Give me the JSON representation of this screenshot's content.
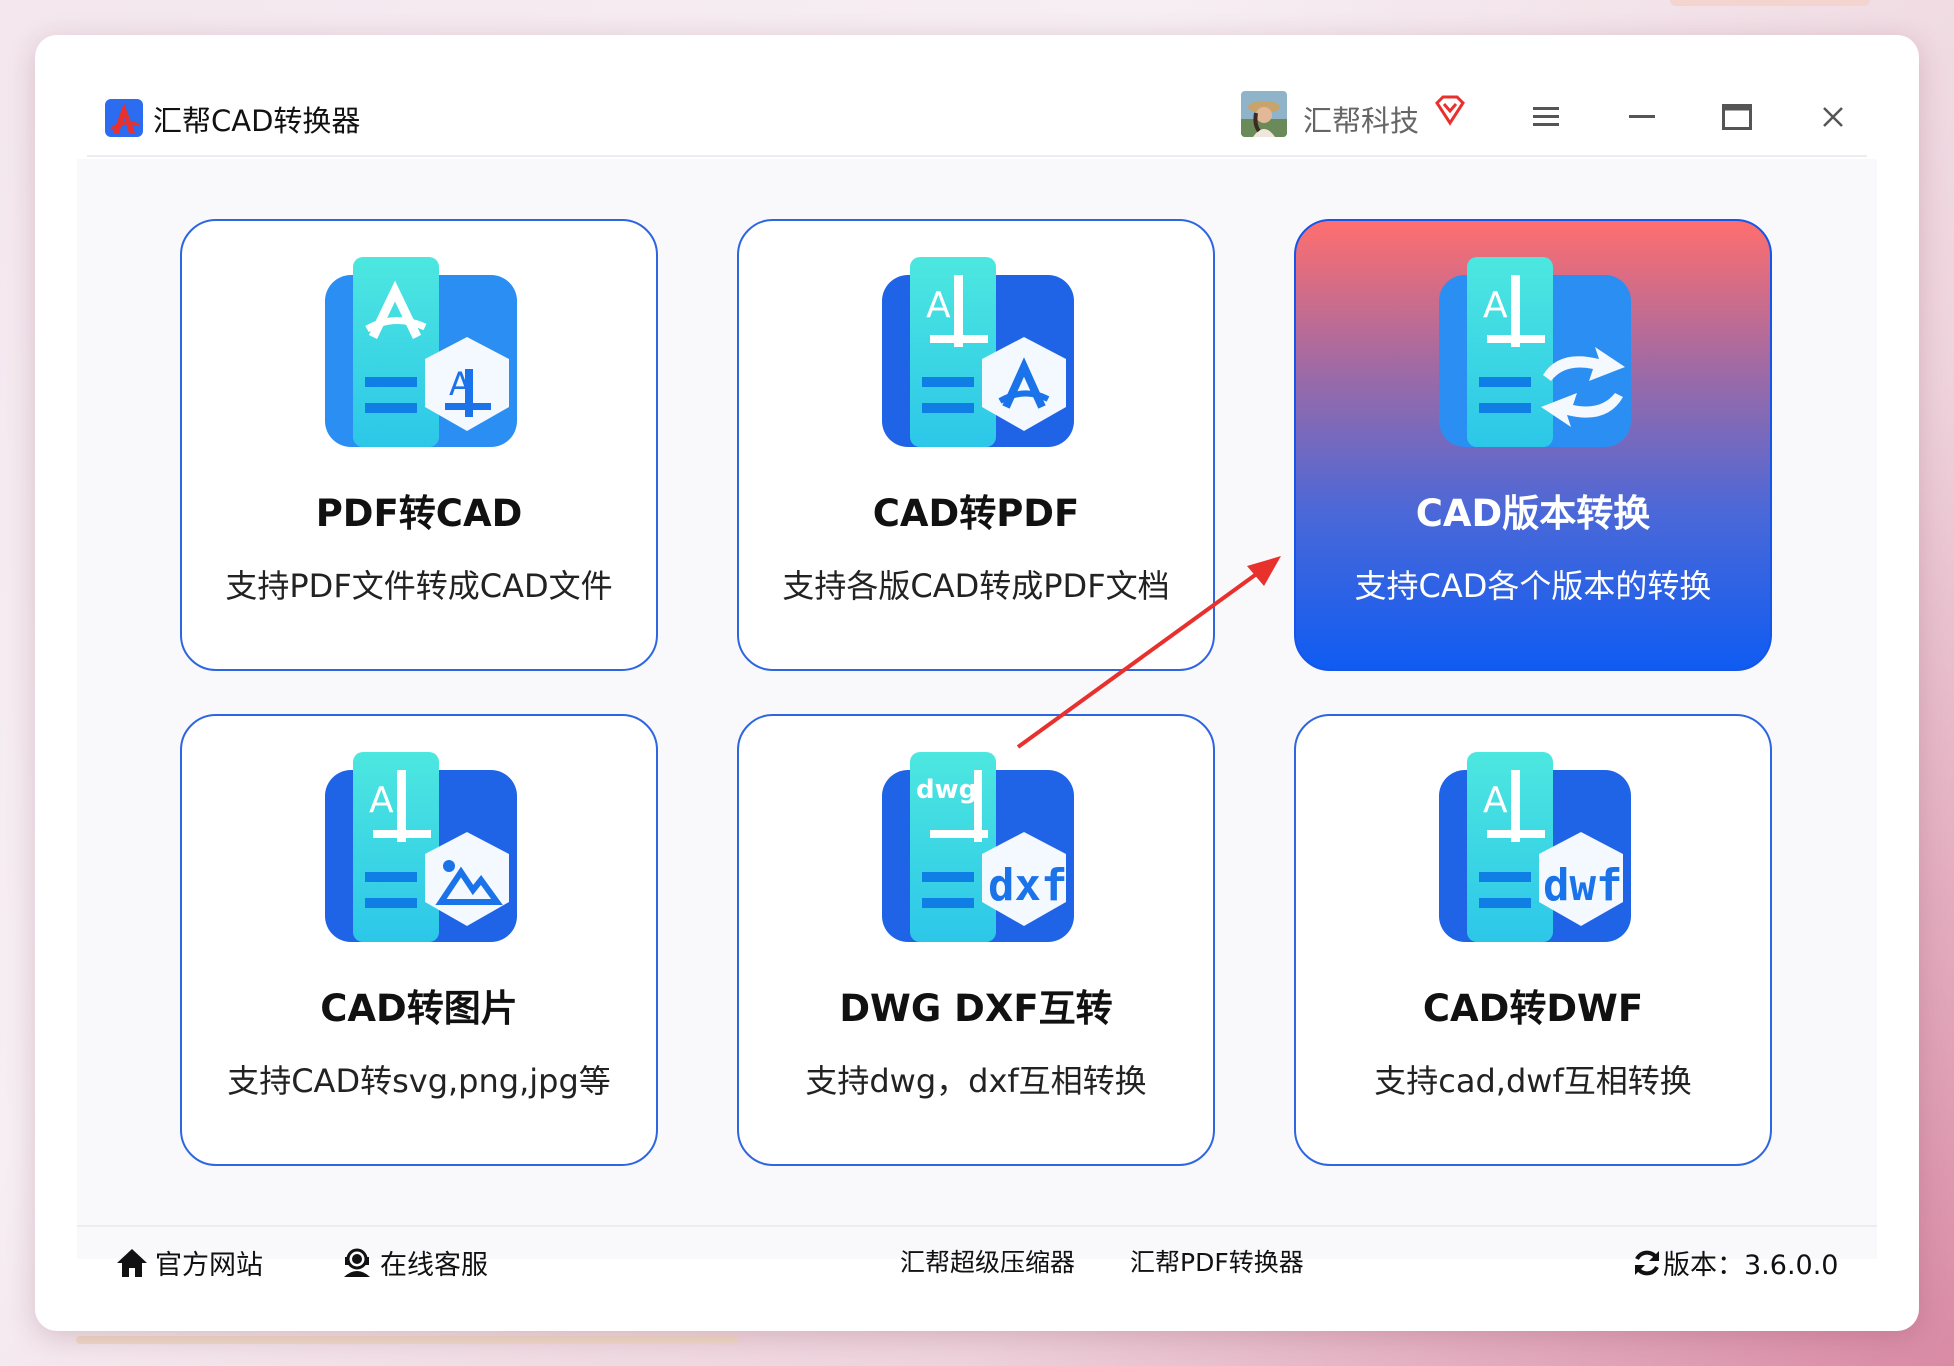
{
  "app": {
    "title": "汇帮CAD转换器"
  },
  "user": {
    "name": "汇帮科技"
  },
  "window_controls": [
    "menu",
    "minimize",
    "maximize",
    "close"
  ],
  "cards": [
    {
      "title": "PDF转CAD",
      "desc": "支持PDF文件转成CAD文件",
      "icon": "pdf-to-cad-icon",
      "active": false
    },
    {
      "title": "CAD转PDF",
      "desc": "支持各版CAD转成PDF文档",
      "icon": "cad-to-pdf-icon",
      "active": false
    },
    {
      "title": "CAD版本转换",
      "desc": "支持CAD各个版本的转换",
      "icon": "cad-version-convert-icon",
      "active": true
    },
    {
      "title": "CAD转图片",
      "desc": "支持CAD转svg,png,jpg等",
      "icon": "cad-to-image-icon",
      "active": false
    },
    {
      "title": "DWG DXF互转",
      "desc": "支持dwg，dxf互相转换",
      "icon": "dwg-dxf-icon",
      "active": false
    },
    {
      "title": "CAD转DWF",
      "desc": "支持cad,dwf互相转换",
      "icon": "cad-to-dwf-icon",
      "active": false
    }
  ],
  "icon_text": {
    "dwg": "dwg",
    "dxf": "dxf",
    "dwf": "dwf",
    "a": "A"
  },
  "footer": {
    "website": "官方网站",
    "support": "在线客服",
    "compressor": "汇帮超级压缩器",
    "pdf_converter": "汇帮PDF转换器",
    "version_label": "版本：3.6.0.0"
  },
  "colors": {
    "accent": "#2d66e0",
    "active_top": "#ff6e6e",
    "active_bottom": "#0f5cf2",
    "arrow": "#e8302c"
  }
}
